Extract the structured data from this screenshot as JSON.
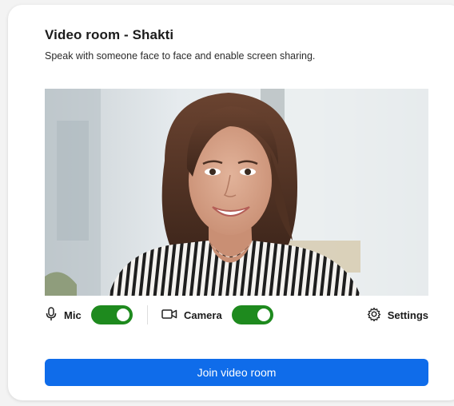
{
  "room": {
    "title": "Video room - Shakti",
    "subtitle": "Speak with someone face to face and enable screen sharing."
  },
  "controls": {
    "mic_label": "Mic",
    "mic_on": true,
    "camera_label": "Camera",
    "camera_on": true,
    "settings_label": "Settings",
    "toggle_color": "#1e8a1e"
  },
  "actions": {
    "join_label": "Join video room",
    "accent": "#0f6cea"
  },
  "icons": [
    "microphone-icon",
    "video-camera-icon",
    "gear-icon"
  ]
}
